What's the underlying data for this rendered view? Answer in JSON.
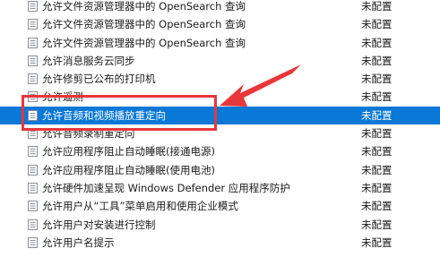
{
  "rows": [
    {
      "name": "允许文件资源管理器中的 OpenSearch 查询",
      "state": "未配置"
    },
    {
      "name": "允许文件资源管理器中的 OpenSearch 查询",
      "state": "未配置"
    },
    {
      "name": "允许文件资源管理器中的 OpenSearch 查询",
      "state": "未配置"
    },
    {
      "name": "允许消息服务云同步",
      "state": "未配置"
    },
    {
      "name": "允许修剪已公布的打印机",
      "state": "未配置"
    },
    {
      "name": "允许遥测",
      "state": "未配置"
    },
    {
      "name": "允许音频和视频播放重定向",
      "state": "未配置"
    },
    {
      "name": "允许音频录制重定向",
      "state": "未配置"
    },
    {
      "name": "允许应用程序阻止自动睡眠(接通电源)",
      "state": "未配置"
    },
    {
      "name": "允许应用程序阻止自动睡眠(使用电池)",
      "state": "未配置"
    },
    {
      "name": "允许硬件加速呈现 Windows Defender 应用程序防护",
      "state": "未配置"
    },
    {
      "name": "允许用户从“工具”菜单启用和使用企业模式",
      "state": "未配置"
    },
    {
      "name": "允许用户对安装进行控制",
      "state": "未配置"
    },
    {
      "name": "允许用户名提示",
      "state": "未配置"
    }
  ],
  "colors": {
    "selection": "#0a78d6",
    "annotation": "#e8363a"
  },
  "icons": {
    "setting": "policy-setting-icon"
  }
}
